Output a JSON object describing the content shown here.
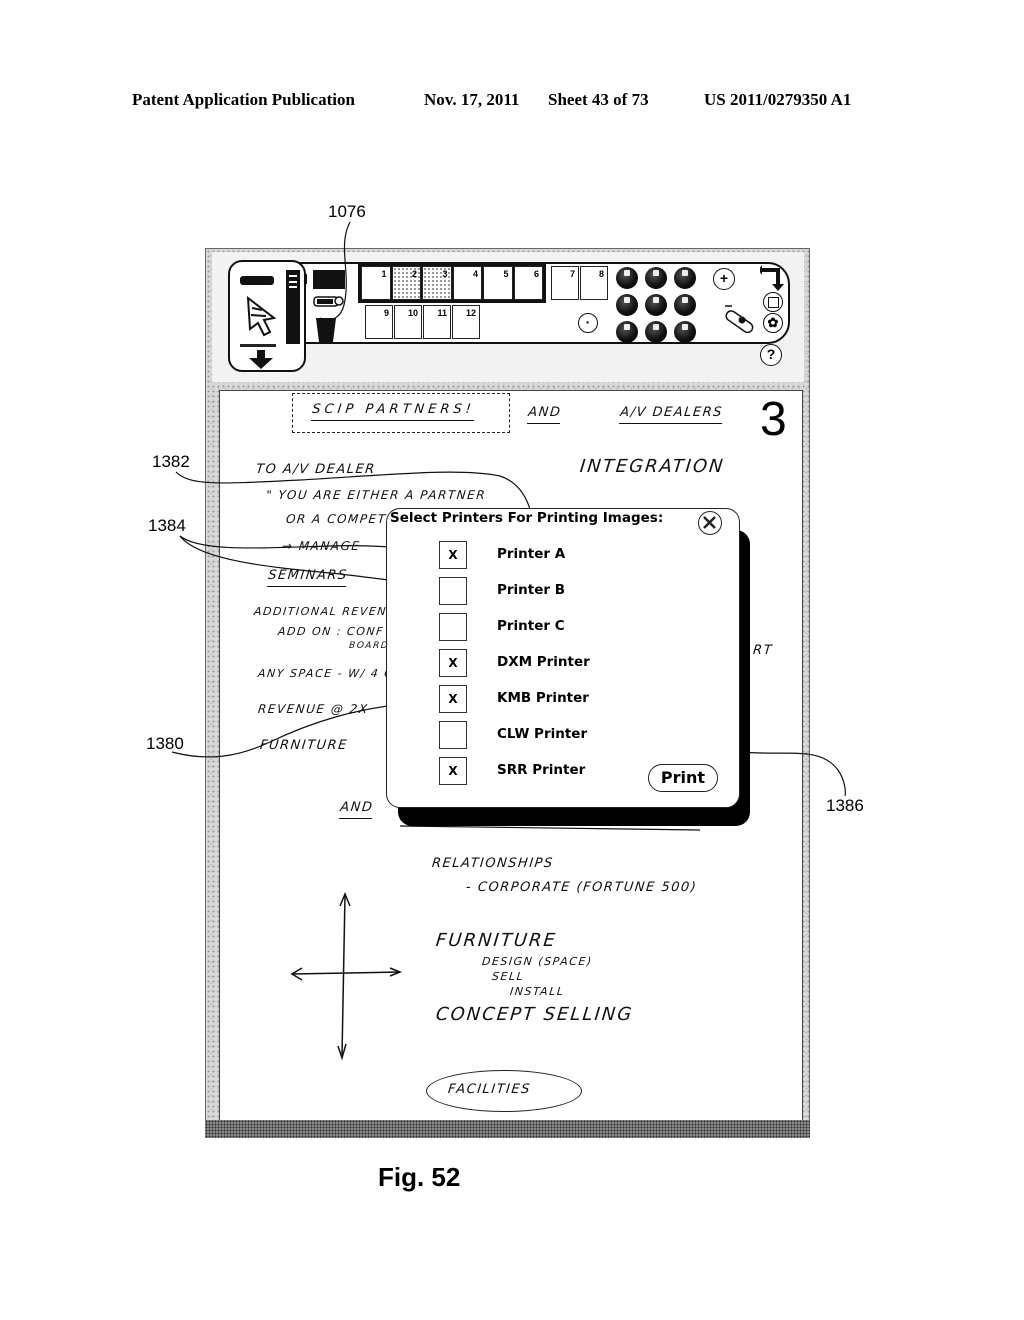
{
  "header": {
    "publication": "Patent Application Publication",
    "date": "Nov. 17, 2011",
    "sheet": "Sheet 43 of 73",
    "number": "US 2011/0279350 A1"
  },
  "references": {
    "toolbar": "1076",
    "arrow_target": "1382",
    "checkboxes": "1384",
    "dialog": "1380",
    "print_button": "1386"
  },
  "toolbar": {
    "page_slots_top": [
      "1",
      "2",
      "3",
      "4",
      "5",
      "6"
    ],
    "page_slots_extra": [
      "7",
      "8"
    ],
    "page_slots_bottom": [
      "9",
      "10",
      "11",
      "12"
    ],
    "zoom_in_label": "+",
    "zoom_out_label": "·",
    "help_label": "?",
    "icons": [
      "eraser-icon",
      "pointer-icon",
      "pen-icon",
      "down-arrow-icon",
      "monitor-icon",
      "tape-icon",
      "trash-icon",
      "color-palette-icon",
      "undo-arrow-icon",
      "save-disk-icon",
      "settings-gear-icon",
      "usb-drive-icon",
      "help-icon"
    ]
  },
  "page_number": "3",
  "handwriting": {
    "title_box": "SCIP PARTNERS!",
    "and_1": "AND",
    "av_dealers": "A/V DEALERS",
    "integration": "INTEGRATION",
    "to_av_dealer": "TO A/V DEALER",
    "quote_1": "\" YOU ARE EITHER A PARTNER",
    "quote_2": "OR A COMPETITOR",
    "manage": "→ MANAGE",
    "seminars": "SEMINARS",
    "additional": "ADDITIONAL REVENUE",
    "add_on": "ADD ON : CONF",
    "boards": "BOARDS",
    "any_space": "ANY SPACE - W/ 4 OR",
    "revenue": "REVENUE @ 2X",
    "furniture_1": "FURNITURE",
    "rt": "RT",
    "and_2": "AND",
    "relationships": "RELATIONSHIPS",
    "corporate": "- CORPORATE (FORTUNE 500)",
    "furniture_2": "FURNITURE",
    "design": "DESIGN (SPACE)",
    "sell": "SELL",
    "install": "INSTALL",
    "concept": "CONCEPT SELLING",
    "facilities": "FACILITIES"
  },
  "dialog": {
    "title": "Select Printers For Printing Images:",
    "close_icon": "close-x-icon",
    "printers": [
      {
        "name": "Printer A",
        "checked": true,
        "mark": "X"
      },
      {
        "name": "Printer B",
        "checked": false,
        "mark": ""
      },
      {
        "name": "Printer C",
        "checked": false,
        "mark": ""
      },
      {
        "name": "DXM Printer",
        "checked": true,
        "mark": "X"
      },
      {
        "name": "KMB Printer",
        "checked": true,
        "mark": "X"
      },
      {
        "name": "CLW Printer",
        "checked": false,
        "mark": ""
      },
      {
        "name": "SRR Printer",
        "checked": true,
        "mark": "X"
      }
    ],
    "print_label": "Print"
  },
  "figure_caption": "Fig. 52"
}
